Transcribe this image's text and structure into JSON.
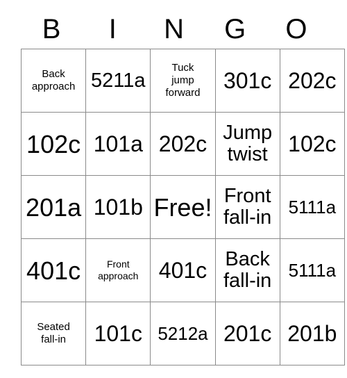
{
  "header": {
    "letters": [
      "B",
      "I",
      "N",
      "G",
      "O"
    ]
  },
  "grid": {
    "rows": [
      [
        {
          "text": "Back\napproach",
          "size": "xs"
        },
        {
          "text": "5211a",
          "size": "md"
        },
        {
          "text": "Tuck\njump\nforward",
          "size": "xs"
        },
        {
          "text": "301c",
          "size": "lg"
        },
        {
          "text": "202c",
          "size": "lg"
        }
      ],
      [
        {
          "text": "102c",
          "size": "xl"
        },
        {
          "text": "101a",
          "size": "lg"
        },
        {
          "text": "202c",
          "size": "lg"
        },
        {
          "text": "Jump\ntwist",
          "size": "md"
        },
        {
          "text": "102c",
          "size": "lg"
        }
      ],
      [
        {
          "text": "201a",
          "size": "xl"
        },
        {
          "text": "101b",
          "size": "lg"
        },
        {
          "text": "Free!",
          "size": "xl"
        },
        {
          "text": "Front\nfall-in",
          "size": "md"
        },
        {
          "text": "5111a",
          "size": "sm"
        }
      ],
      [
        {
          "text": "401c",
          "size": "xl"
        },
        {
          "text": "Front\napproach",
          "size": "xxs"
        },
        {
          "text": "401c",
          "size": "lg"
        },
        {
          "text": "Back\nfall-in",
          "size": "md"
        },
        {
          "text": "5111a",
          "size": "sm"
        }
      ],
      [
        {
          "text": "Seated\nfall-in",
          "size": "xs"
        },
        {
          "text": "101c",
          "size": "lg"
        },
        {
          "text": "5212a",
          "size": "sm"
        },
        {
          "text": "201c",
          "size": "lg"
        },
        {
          "text": "201b",
          "size": "lg"
        }
      ]
    ]
  },
  "colors": {
    "background": "#ffffff",
    "text": "#000000",
    "grid_line": "#8a8a8a"
  }
}
